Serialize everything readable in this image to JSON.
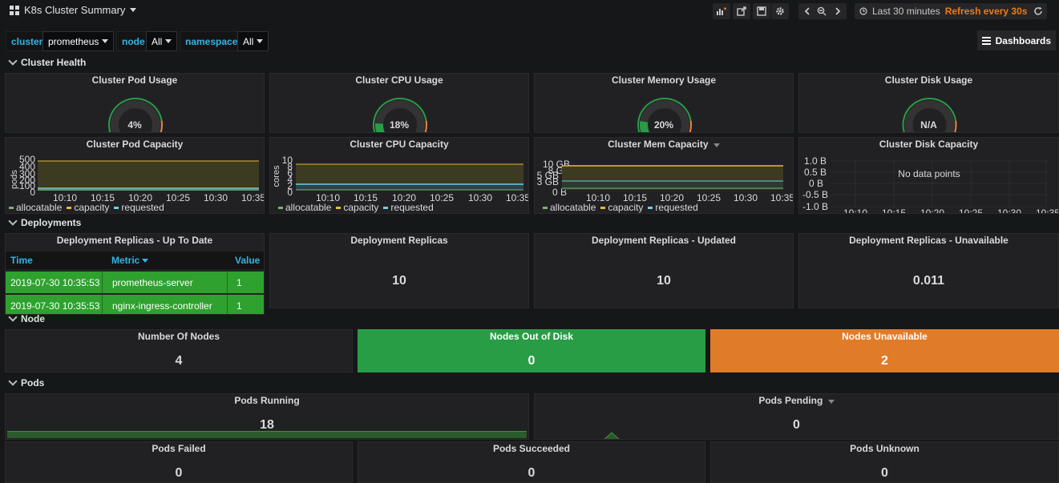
{
  "header": {
    "title": "K8s Cluster Summary",
    "time_range": "Last 30 minutes",
    "refresh": "Refresh every 30s",
    "dashboards_label": "Dashboards"
  },
  "variables": [
    {
      "label": "cluster",
      "value": "prometheus"
    },
    {
      "label": "node",
      "value": "All"
    },
    {
      "label": "namespace",
      "value": "All"
    }
  ],
  "rows": {
    "cluster_health": "Cluster Health",
    "deployments": "Deployments",
    "node": "Node",
    "pods": "Pods"
  },
  "gauges": [
    {
      "title": "Cluster Pod Usage",
      "value": "4%",
      "fraction": 0.04
    },
    {
      "title": "Cluster CPU Usage",
      "value": "18%",
      "fraction": 0.18
    },
    {
      "title": "Cluster Memory Usage",
      "value": "20%",
      "fraction": 0.2
    },
    {
      "title": "Cluster Disk Usage",
      "value": "N/A",
      "fraction": 0
    }
  ],
  "capacity_charts": {
    "pod": {
      "title": "Cluster Pod Capacity",
      "ylabel": "pods",
      "yticks": [
        "500",
        "400",
        "300",
        "200",
        "100",
        "0"
      ]
    },
    "cpu": {
      "title": "Cluster CPU Capacity",
      "ylabel": "cores",
      "yticks": [
        "10",
        "8",
        "6",
        "4",
        "2",
        "0"
      ]
    },
    "mem": {
      "title": "Cluster Mem Capacity",
      "yticks": [
        "10 GB",
        "8 GB",
        "5 GB",
        "3 GB",
        "0 B"
      ]
    },
    "disk": {
      "title": "Cluster Disk Capacity",
      "no_data": "No data points",
      "yticks": [
        "1.0 B",
        "0.5 B",
        "0 B",
        "-0.5 B",
        "-1.0 B"
      ]
    },
    "xticks": [
      "10:10",
      "10:15",
      "10:20",
      "10:25",
      "10:30",
      "10:35"
    ],
    "legend": [
      "allocatable",
      "capacity",
      "requested"
    ],
    "colors": {
      "allocatable": "#7eb26d",
      "capacity": "#eab839",
      "requested": "#6ed0e0"
    }
  },
  "deployment_table": {
    "title": "Deployment Replicas - Up To Date",
    "columns": [
      "Time",
      "Metric",
      "Value"
    ],
    "rows": [
      [
        "2019-07-30 10:35:53",
        "prometheus-server",
        "1"
      ],
      [
        "2019-07-30 10:35:53",
        "nginx-ingress-controller",
        "1"
      ]
    ]
  },
  "deployment_stats": [
    {
      "title": "Deployment Replicas",
      "value": "10"
    },
    {
      "title": "Deployment Replicas - Updated",
      "value": "10"
    },
    {
      "title": "Deployment Replicas - Unavailable",
      "value": "0.011"
    }
  ],
  "node_stats": [
    {
      "title": "Number Of Nodes",
      "value": "4"
    },
    {
      "title": "Nodes Out of Disk",
      "value": "0"
    },
    {
      "title": "Nodes Unavailable",
      "value": "2"
    }
  ],
  "pod_stats": [
    {
      "title": "Pods Running",
      "value": "18"
    },
    {
      "title": "Pods Pending",
      "value": "0"
    },
    {
      "title": "Pods Failed",
      "value": "0"
    },
    {
      "title": "Pods Succeeded",
      "value": "0"
    },
    {
      "title": "Pods Unknown",
      "value": "0"
    }
  ]
}
